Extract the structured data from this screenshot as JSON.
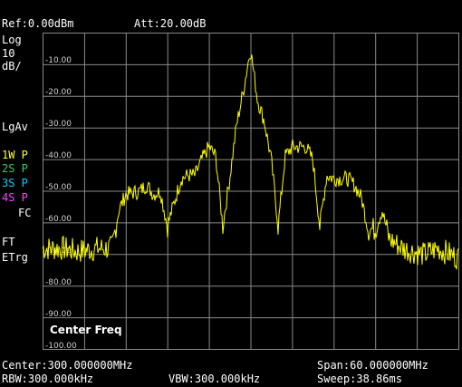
{
  "header": {
    "ref": "Ref:0.00dBm",
    "att": "Att:20.00dB"
  },
  "left_panel": {
    "scale_label": "Log",
    "scale_value": "10",
    "scale_unit": "dB/",
    "detector": "LgAv",
    "traces": [
      {
        "label": "1W P",
        "color": "#ffff33"
      },
      {
        "label": "2S P",
        "color": "#33cc66"
      },
      {
        "label": "3S P",
        "color": "#00d0ff"
      },
      {
        "label": "4S P",
        "color": "#ff44ff"
      }
    ],
    "fc": "FC",
    "ft": "FT",
    "etrg": "ETrg"
  },
  "softkey": "Center Freq",
  "footer": {
    "center": "Center:300.000000MHz",
    "span": "Span:60.000000MHz",
    "rbw": "RBW:300.000kHz",
    "vbw": "VBW:300.000kHz",
    "sweep": "Sweep:38.86ms"
  },
  "colors": {
    "trace": "#ffff00",
    "grid": "#8a8a8a",
    "background": "#000000"
  },
  "chart_data": {
    "type": "line",
    "y_tick_labels": [
      "-10.00",
      "-20.00",
      "-30.00",
      "-40.00",
      "-50.00",
      "-60.00",
      "-70.00",
      "-80.00",
      "-90.00",
      "-100.00"
    ],
    "ylim": [
      -100,
      0
    ],
    "x_divisions": 10,
    "grid": true,
    "x": [
      270,
      273,
      275,
      278,
      280,
      281,
      282,
      284,
      285,
      286,
      287,
      288,
      290,
      291,
      292,
      293,
      294,
      295,
      296,
      297,
      298,
      299,
      300,
      301,
      302,
      303,
      304,
      305,
      306,
      308,
      309,
      310,
      311,
      312,
      314,
      315,
      316,
      317,
      318,
      319,
      320,
      322,
      325,
      327,
      330
    ],
    "series": [
      {
        "values": [
          -68,
          -68,
          -69,
          -68,
          -68,
          -56,
          -51,
          -50,
          -48,
          -51,
          -50,
          -61,
          -46,
          -45,
          -45,
          -40,
          -36,
          -39,
          -61,
          -46,
          -29,
          -18,
          -5,
          -21,
          -28,
          -40,
          -61,
          -39,
          -36,
          -36,
          -40,
          -61,
          -45,
          -46,
          -46,
          -48,
          -52,
          -62,
          -62,
          -56,
          -65,
          -68,
          -70,
          -68,
          -71
        ]
      }
    ]
  }
}
